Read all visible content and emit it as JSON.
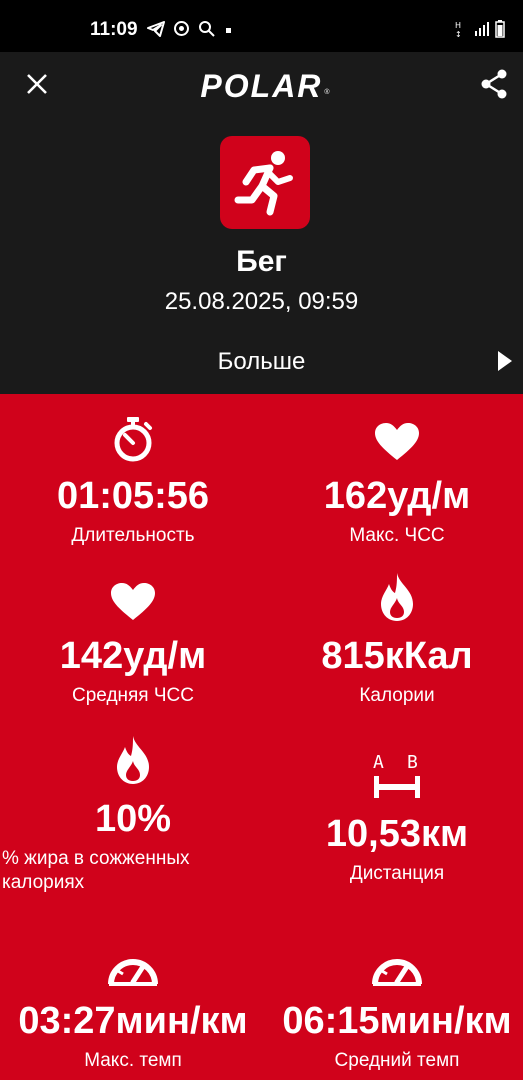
{
  "status_bar": {
    "time": "11:09",
    "icons": [
      "telegram-icon",
      "sync-icon",
      "search-icon",
      "dot-icon",
      "network-icon",
      "signal-icon",
      "battery-icon"
    ]
  },
  "app_bar": {
    "logo_text": "POLAR",
    "close_icon": "close-icon",
    "share_icon": "share-icon"
  },
  "activity": {
    "icon": "running-icon",
    "name": "Бег",
    "datetime": "25.08.2025, 09:59",
    "more_label": "Больше"
  },
  "stats": [
    {
      "icon": "stopwatch-icon",
      "value": "01:05:56",
      "label": "Длительность"
    },
    {
      "icon": "heart-icon",
      "value": "162уд/м",
      "label": "Макс. ЧСС"
    },
    {
      "icon": "heart-icon",
      "value": "142уд/м",
      "label": "Средняя ЧСС"
    },
    {
      "icon": "flame-icon",
      "value": "815кКал",
      "label": "Калории"
    },
    {
      "icon": "flame-icon",
      "value": "10%",
      "label": "% жира в сожженных калориях"
    },
    {
      "icon": "distance-icon",
      "value": "10,53км",
      "label": "Дистанция",
      "icon_text_a": "A",
      "icon_text_b": "B"
    },
    {
      "icon": "speedometer-icon",
      "value": "03:27мин/км",
      "label": "Макс. темп"
    },
    {
      "icon": "speedometer-icon",
      "value": "06:15мин/км",
      "label": "Средний темп"
    }
  ],
  "colors": {
    "brand_red": "#d0021b",
    "header_bg": "#1a1a1a",
    "text": "#ffffff"
  }
}
